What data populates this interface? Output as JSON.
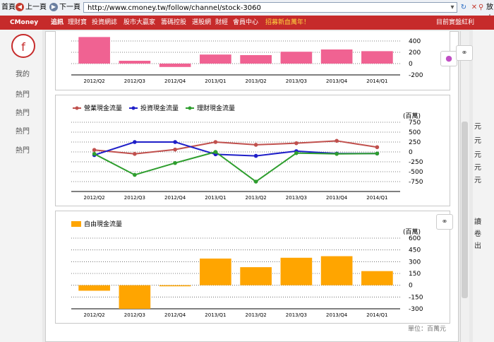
{
  "browser": {
    "home_label": "首頁",
    "back_label": "上一頁",
    "forward_label": "下一頁",
    "url": "http://www.cmoney.tw/follow/channel/stock-3060",
    "right_partial": "放大"
  },
  "nav": {
    "brand": "CMoney",
    "items": [
      "追訊",
      "理財寶",
      "投資網誌",
      "股市大贏家",
      "籌碼控股",
      "選股網",
      "財經",
      "會員中心"
    ],
    "promo": "招募新血萬年！",
    "right_text": "目前實盤紅利"
  },
  "sidebar": {
    "logo_text": "f",
    "items": [
      "我的",
      "熱門",
      "熱門",
      "熱門",
      "熱門"
    ]
  },
  "right_panel": {
    "items": [
      "元",
      "元",
      "元",
      "元",
      "元"
    ],
    "lower": [
      "讀",
      "卷",
      "出"
    ]
  },
  "unit_footer": "單位：百萬元",
  "chart_data": [
    {
      "type": "bar",
      "categories": [
        "2012/Q2",
        "2012/Q3",
        "2012/Q4",
        "2013/Q1",
        "2013/Q2",
        "2013/Q3",
        "2013/Q4",
        "2014/Q1"
      ],
      "values": [
        470,
        50,
        -60,
        160,
        150,
        210,
        250,
        220
      ],
      "ylim": [
        -200,
        400
      ],
      "yticks": [
        400,
        200,
        0,
        -200
      ],
      "color": "#f06292",
      "grid": true
    },
    {
      "type": "line",
      "categories": [
        "2012/Q2",
        "2012/Q3",
        "2012/Q4",
        "2013/Q1",
        "2013/Q2",
        "2013/Q3",
        "2013/Q4",
        "2014/Q1"
      ],
      "unit": "(百萬)",
      "ylim": [
        -1000,
        750
      ],
      "yticks": [
        750,
        500,
        250,
        0,
        -250,
        -500,
        -750
      ],
      "legend_position": "top-left",
      "grid": true,
      "series": [
        {
          "name": "營業現金流量",
          "color": "#c0504d",
          "values": [
            50,
            -50,
            60,
            250,
            180,
            220,
            280,
            120
          ]
        },
        {
          "name": "投資現金流量",
          "color": "#1f1fc8",
          "values": [
            -80,
            250,
            250,
            -60,
            -100,
            20,
            -40,
            -40
          ]
        },
        {
          "name": "理財現金流量",
          "color": "#2e9e2e",
          "values": [
            -50,
            -580,
            -280,
            0,
            -750,
            -30,
            -50,
            -40
          ]
        }
      ]
    },
    {
      "type": "bar",
      "categories": [
        "2012/Q2",
        "2012/Q3",
        "2012/Q4",
        "2013/Q1",
        "2013/Q2",
        "2013/Q3",
        "2013/Q4",
        "2014/Q1"
      ],
      "unit": "(百萬)",
      "values": [
        -70,
        -300,
        -10,
        340,
        230,
        350,
        370,
        180
      ],
      "ylim": [
        -300,
        600
      ],
      "yticks": [
        600,
        450,
        300,
        150,
        0,
        -150,
        -300
      ],
      "legend": "自由現金流量",
      "legend_position": "top-left",
      "color": "#ffa500",
      "grid": true
    }
  ]
}
